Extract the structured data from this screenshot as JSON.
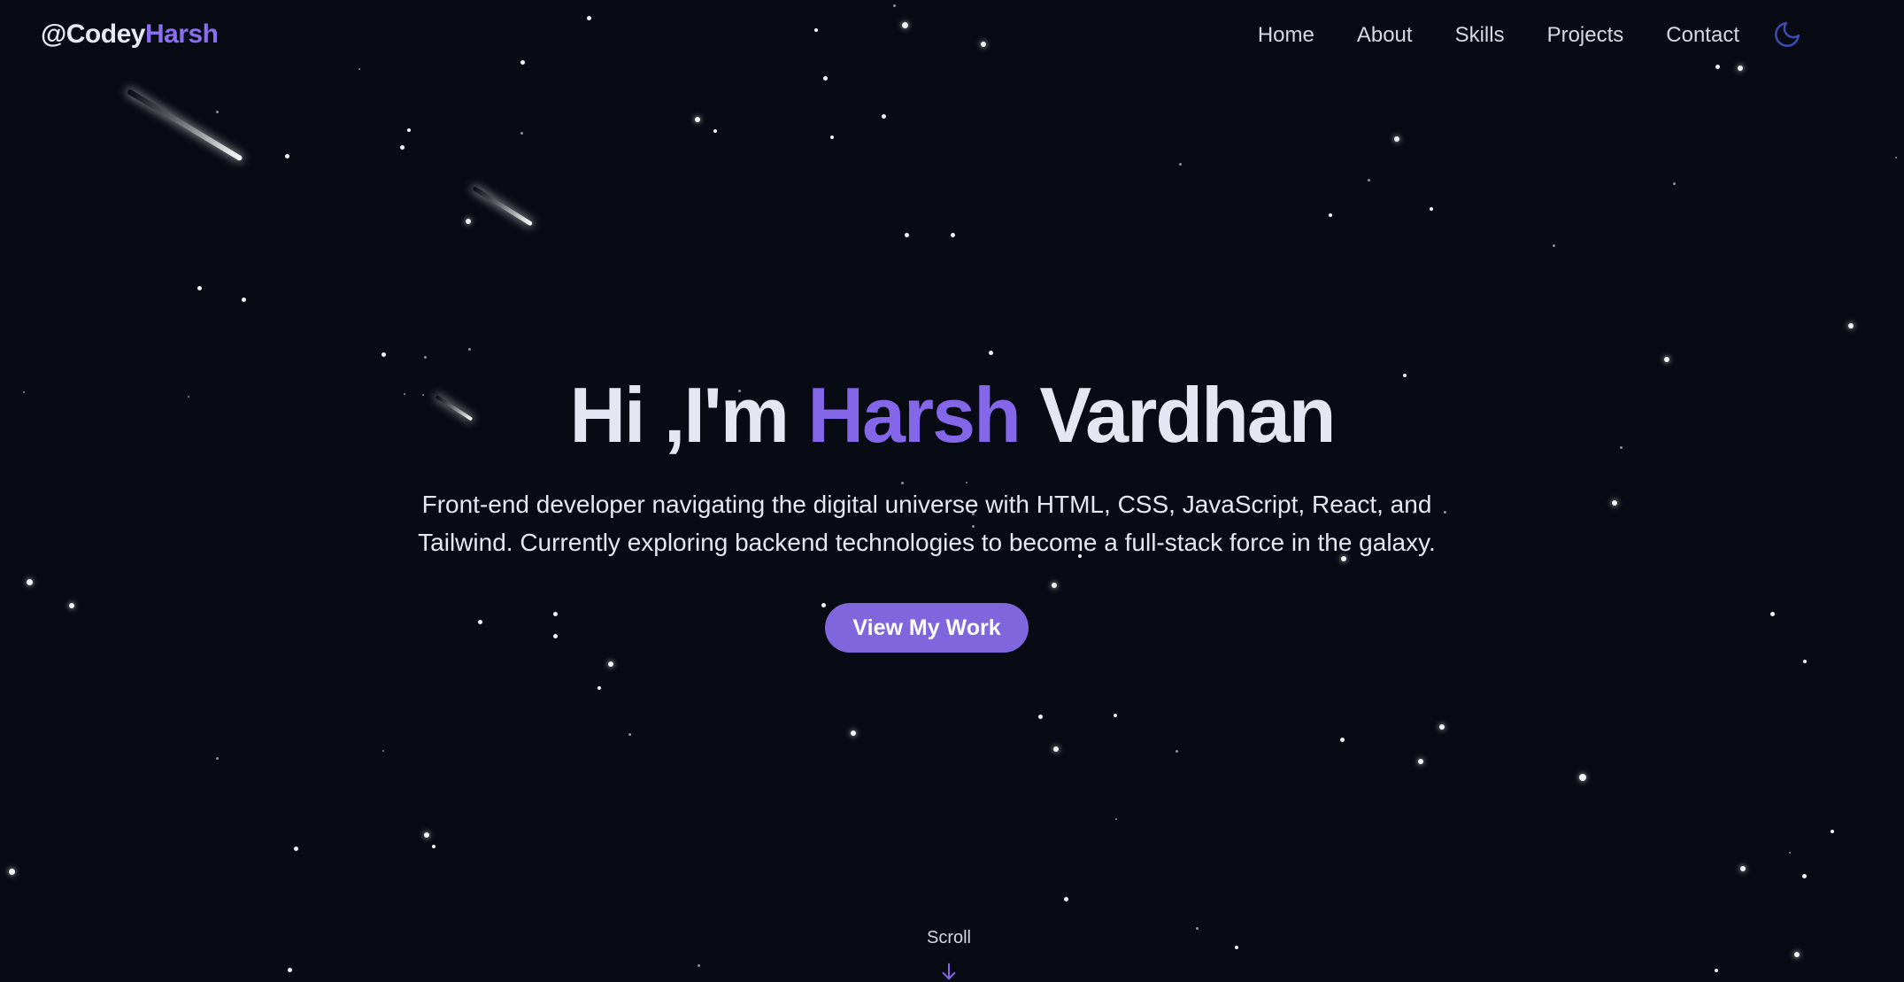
{
  "brand": {
    "prefix": "@Codey",
    "name": "Harsh"
  },
  "nav": {
    "items": [
      "Home",
      "About",
      "Skills",
      "Projects",
      "Contact"
    ],
    "theme_toggle_icon": "moon-icon"
  },
  "hero": {
    "greeting": "Hi ,I'm",
    "first_name": "Harsh",
    "last_name": "Vardhan",
    "subtitle": "Front-end developer navigating the digital universe with HTML, CSS, JavaScript, React, and Tailwind. Currently exploring backend technologies to become a full-stack force in the galaxy.",
    "cta_label": "View My Work"
  },
  "scroll": {
    "label": "Scroll",
    "icon": "arrow-down-icon"
  },
  "colors": {
    "background": "#080b14",
    "accent": "#8466e8",
    "button": "#8066dd",
    "text": "#e4e6f2",
    "toggle": "#3b4bb0"
  }
}
